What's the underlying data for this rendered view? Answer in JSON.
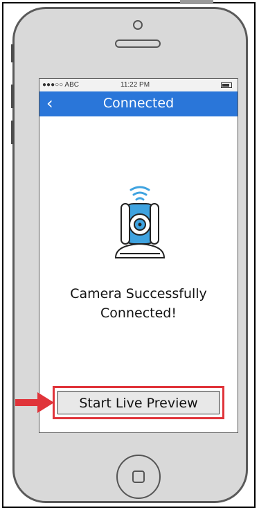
{
  "status_bar": {
    "carrier": "●●●○○ ABC",
    "time": "11:22 PM"
  },
  "navbar": {
    "back_label": "‹",
    "title": "Connected"
  },
  "main": {
    "message_line1": "Camera Successfully",
    "message_line2": "Connected!"
  },
  "cta": {
    "label": "Start Live Preview"
  },
  "colors": {
    "navbar": "#2a76d9",
    "highlight": "#e0343a",
    "camera_accent": "#3fa3e0"
  },
  "icons": [
    "camera-icon",
    "wifi-icon",
    "back-arrow-icon",
    "battery-icon",
    "pointer-arrow-icon",
    "home-button-icon"
  ]
}
